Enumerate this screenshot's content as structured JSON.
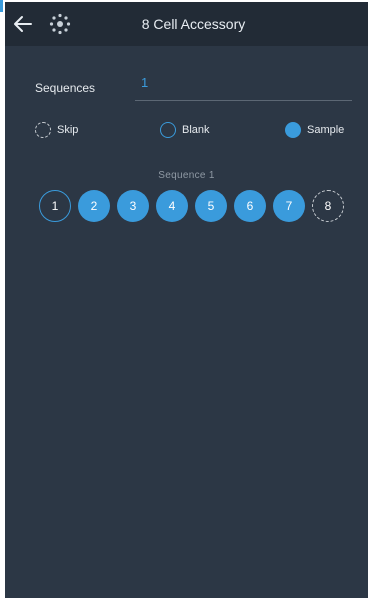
{
  "app_bar": {
    "title": "8 Cell Accessory",
    "back_icon": "arrow-left-icon",
    "cell_icon": "cell-accessory-icon"
  },
  "sequences": {
    "label": "Sequences",
    "value": "1"
  },
  "legend": [
    {
      "label": "Skip",
      "style": "skip"
    },
    {
      "label": "Blank",
      "style": "blank"
    },
    {
      "label": "Sample",
      "style": "sample"
    }
  ],
  "sequence_caption": "Sequence  1",
  "cells": [
    {
      "number": "1",
      "state": "blank"
    },
    {
      "number": "2",
      "state": "sample"
    },
    {
      "number": "3",
      "state": "sample"
    },
    {
      "number": "4",
      "state": "sample"
    },
    {
      "number": "5",
      "state": "sample"
    },
    {
      "number": "6",
      "state": "sample"
    },
    {
      "number": "7",
      "state": "sample"
    },
    {
      "number": "8",
      "state": "skip"
    }
  ],
  "colors": {
    "accent": "#3a9bdc",
    "background": "#2c3745",
    "app_bar": "#222b36"
  }
}
